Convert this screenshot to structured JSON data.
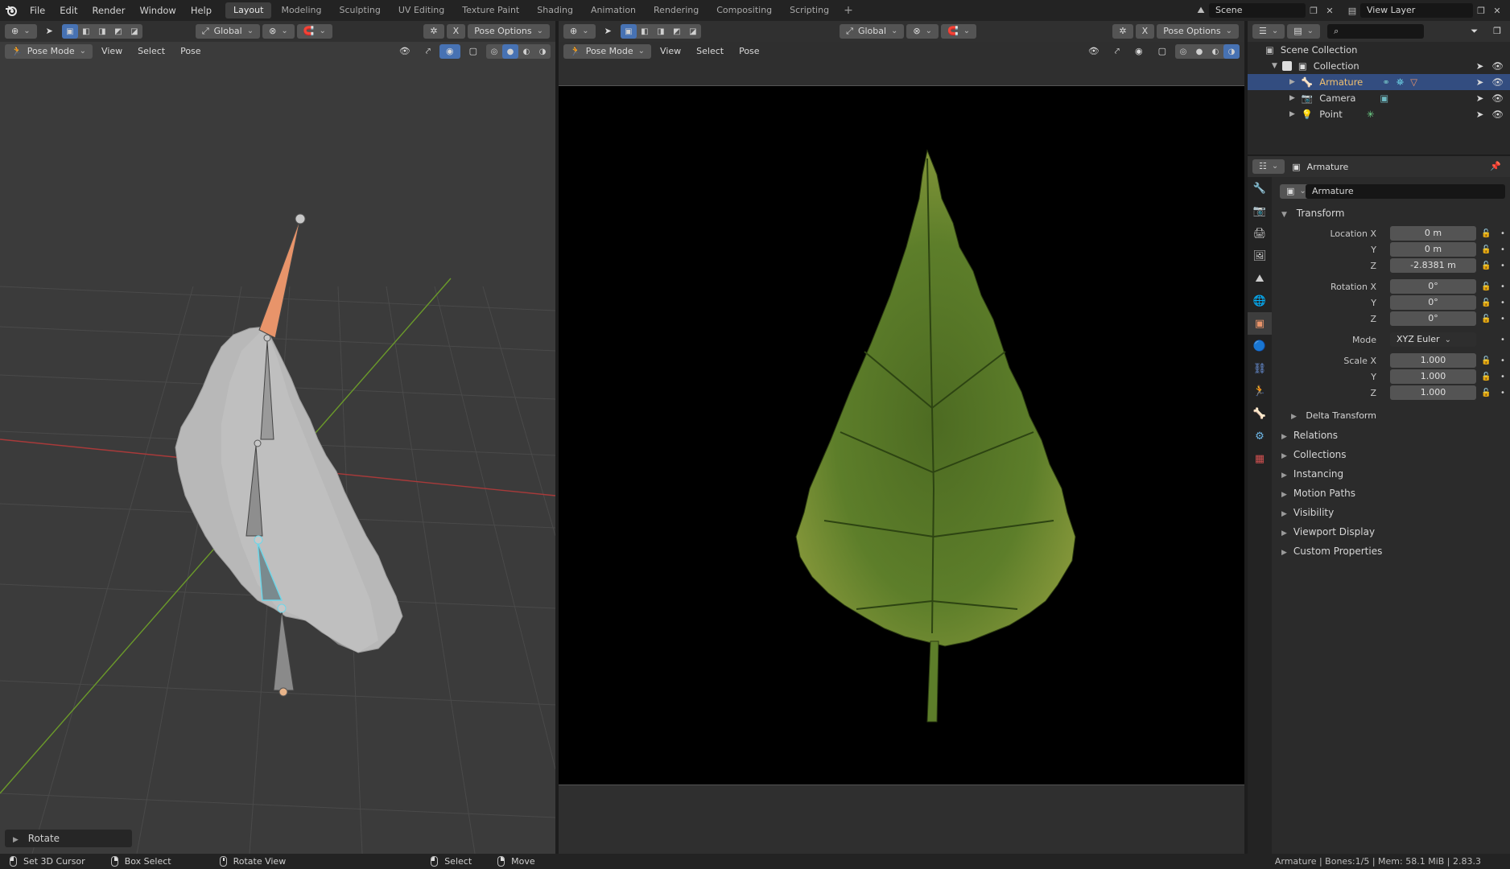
{
  "menu": [
    "File",
    "Edit",
    "Render",
    "Window",
    "Help"
  ],
  "workspaces": [
    {
      "label": "Layout",
      "active": true
    },
    {
      "label": "Modeling"
    },
    {
      "label": "Sculpting"
    },
    {
      "label": "UV Editing"
    },
    {
      "label": "Texture Paint"
    },
    {
      "label": "Shading"
    },
    {
      "label": "Animation"
    },
    {
      "label": "Rendering"
    },
    {
      "label": "Compositing"
    },
    {
      "label": "Scripting"
    }
  ],
  "scene": {
    "name": "Scene",
    "view_layer": "View Layer"
  },
  "viewport_left": {
    "transform_orientation": "Global",
    "pose_options": "Pose Options",
    "mode": "Pose Mode",
    "menus": [
      "View",
      "Select",
      "Pose"
    ],
    "last_operator": "Rotate"
  },
  "viewport_right": {
    "transform_orientation": "Global",
    "pose_options": "Pose Options",
    "mode": "Pose Mode",
    "menus": [
      "View",
      "Select",
      "Pose"
    ]
  },
  "outliner": {
    "root": "Scene Collection",
    "collection": "Collection",
    "objects": [
      "Armature",
      "Camera",
      "Point"
    ],
    "selected": "Armature"
  },
  "properties": {
    "header_object": "Armature",
    "object_name": "Armature",
    "transform_title": "Transform",
    "location": {
      "label": "Location X",
      "x": "0 m",
      "y": "0 m",
      "z": "-2.8381 m"
    },
    "rotation": {
      "label": "Rotation X",
      "x": "0°",
      "y": "0°",
      "z": "0°"
    },
    "mode": {
      "label": "Mode",
      "value": "XYZ Euler"
    },
    "scale": {
      "label": "Scale X",
      "x": "1.000",
      "y": "1.000",
      "z": "1.000"
    },
    "axis_y": "Y",
    "axis_z": "Z",
    "delta": "Delta Transform",
    "sections": [
      "Relations",
      "Collections",
      "Instancing",
      "Motion Paths",
      "Visibility",
      "Viewport Display",
      "Custom Properties"
    ]
  },
  "statusbar": {
    "set_cursor": "Set 3D Cursor",
    "box_select": "Box Select",
    "rotate_view": "Rotate View",
    "select": "Select",
    "move": "Move",
    "info": "Armature | Bones:1/5 | Mem: 58.1 MiB | 2.83.3"
  },
  "colors": {
    "accent": "#4772b3",
    "selected_row": "#334d80",
    "bone_active": "#e8946a",
    "bone_selected": "#6fd6e8",
    "x_axis": "#a83a3a",
    "y_axis": "#6b9a2a"
  }
}
